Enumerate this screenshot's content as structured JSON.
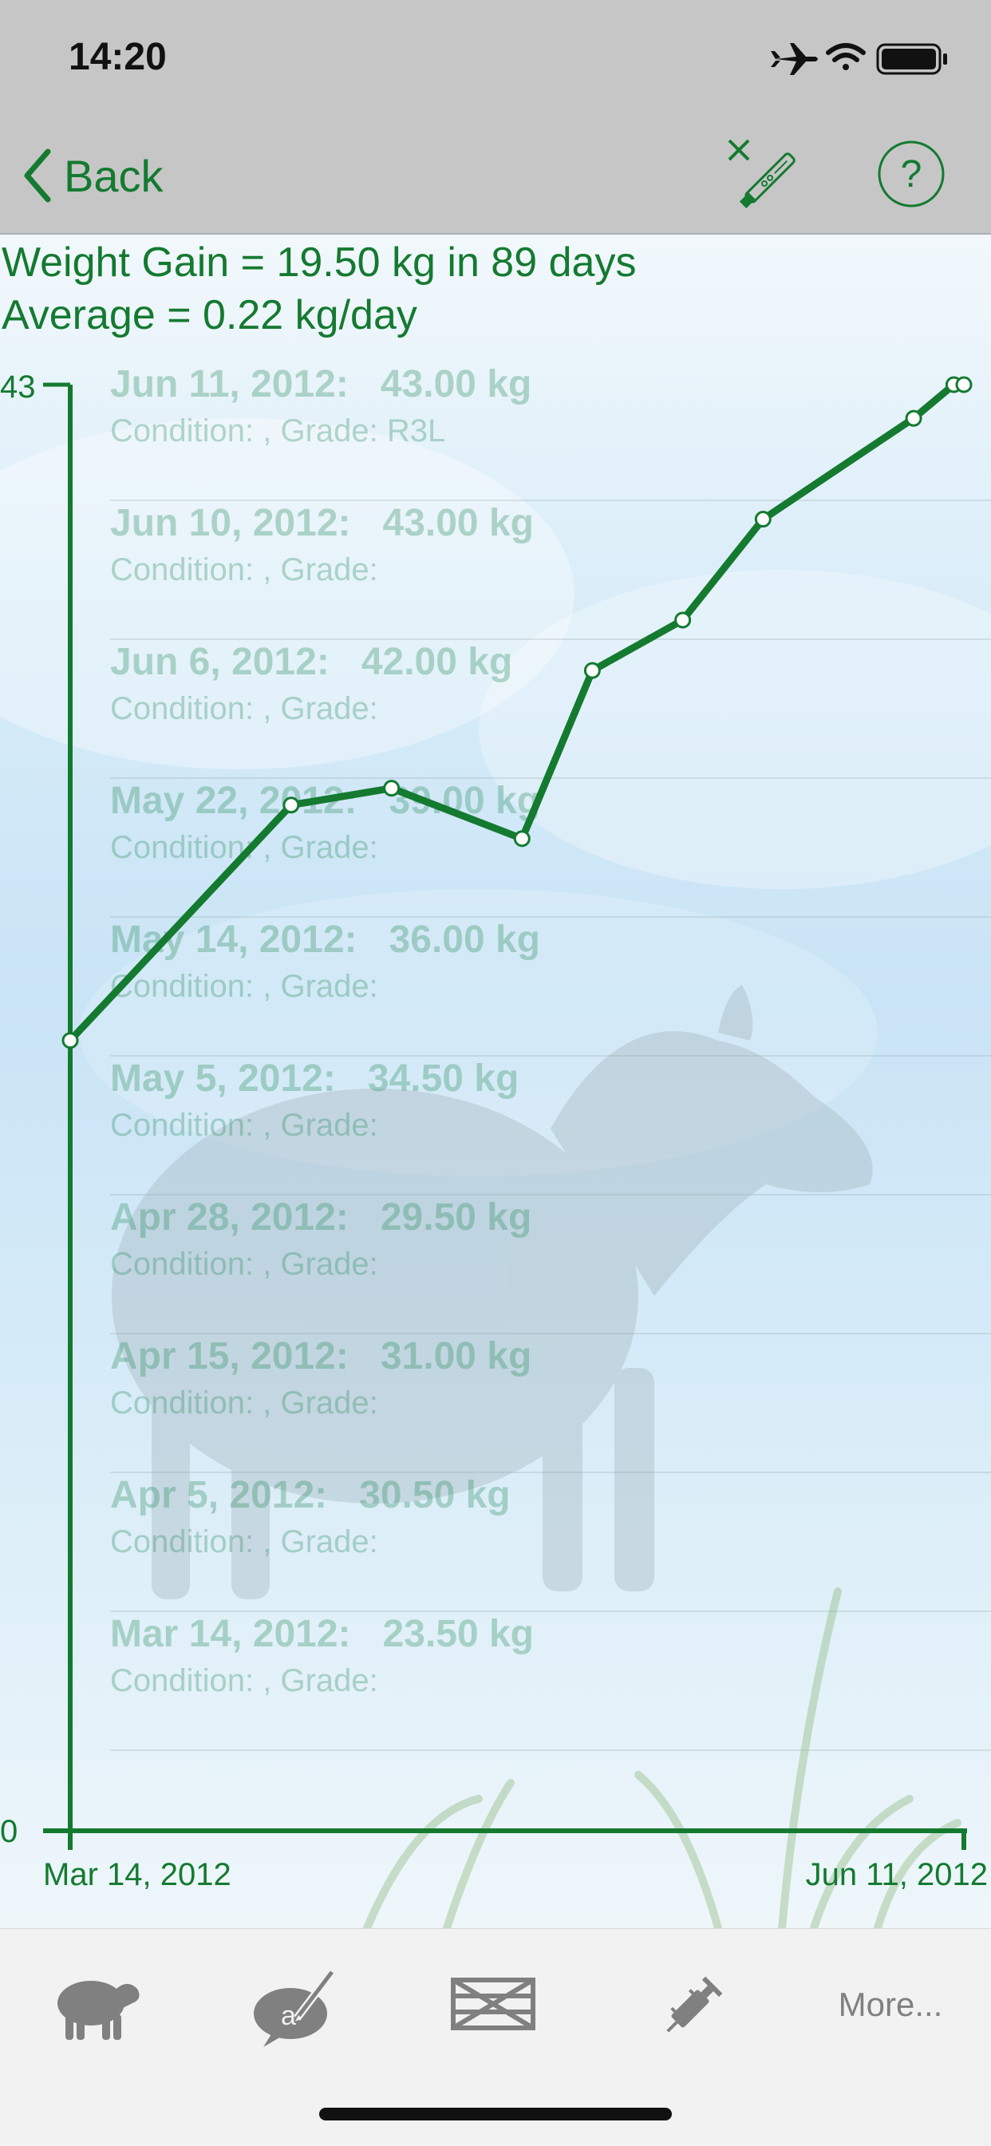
{
  "status_bar": {
    "time": "14:20"
  },
  "nav": {
    "back_label": "Back"
  },
  "summary": {
    "gain_line": "Weight Gain = 19.50 kg in 89 days",
    "average_line": "Average = 0.22 kg/day"
  },
  "entries": [
    {
      "main": "Jun 11, 2012:   43.00 kg",
      "sub": "Condition: , Grade: R3L"
    },
    {
      "main": "Jun 10, 2012:   43.00 kg",
      "sub": "Condition: , Grade:"
    },
    {
      "main": "Jun 6, 2012:   42.00 kg",
      "sub": "Condition: , Grade:"
    },
    {
      "main": "May 22, 2012:   39.00 kg",
      "sub": "Condition: , Grade:"
    },
    {
      "main": "May 14, 2012:   36.00 kg",
      "sub": "Condition: , Grade:"
    },
    {
      "main": "May 5, 2012:   34.50 kg",
      "sub": "Condition: , Grade:"
    },
    {
      "main": "Apr 28, 2012:   29.50 kg",
      "sub": "Condition: , Grade:"
    },
    {
      "main": "Apr 15, 2012:   31.00 kg",
      "sub": "Condition: , Grade:"
    },
    {
      "main": "Apr 5, 2012:   30.50 kg",
      "sub": "Condition: , Grade:"
    },
    {
      "main": "Mar 14, 2012:   23.50 kg",
      "sub": "Condition: , Grade:"
    }
  ],
  "chart_data": {
    "type": "line",
    "x_dates": [
      "2012-03-14",
      "2012-04-05",
      "2012-04-15",
      "2012-04-28",
      "2012-05-05",
      "2012-05-14",
      "2012-05-22",
      "2012-06-06",
      "2012-06-10",
      "2012-06-11"
    ],
    "values": [
      23.5,
      30.5,
      31.0,
      29.5,
      34.5,
      36.0,
      39.0,
      42.0,
      43.0,
      43.0
    ],
    "ylim": [
      0,
      43
    ],
    "y_ticks": [
      "0",
      "43"
    ],
    "x_ticks": [
      "Mar 14, 2012",
      "Jun 11, 2012"
    ],
    "color": "#147a30"
  },
  "tab_bar": {
    "items": [
      {
        "icon": "sheep-icon"
      },
      {
        "icon": "note-pen-icon"
      },
      {
        "icon": "gate-icon"
      },
      {
        "icon": "syringe-icon"
      }
    ],
    "more_label": "More..."
  },
  "colors": {
    "accent": "#147a30",
    "nav_bg": "#c6c6c6",
    "tab_bg": "#f2f2f2"
  }
}
